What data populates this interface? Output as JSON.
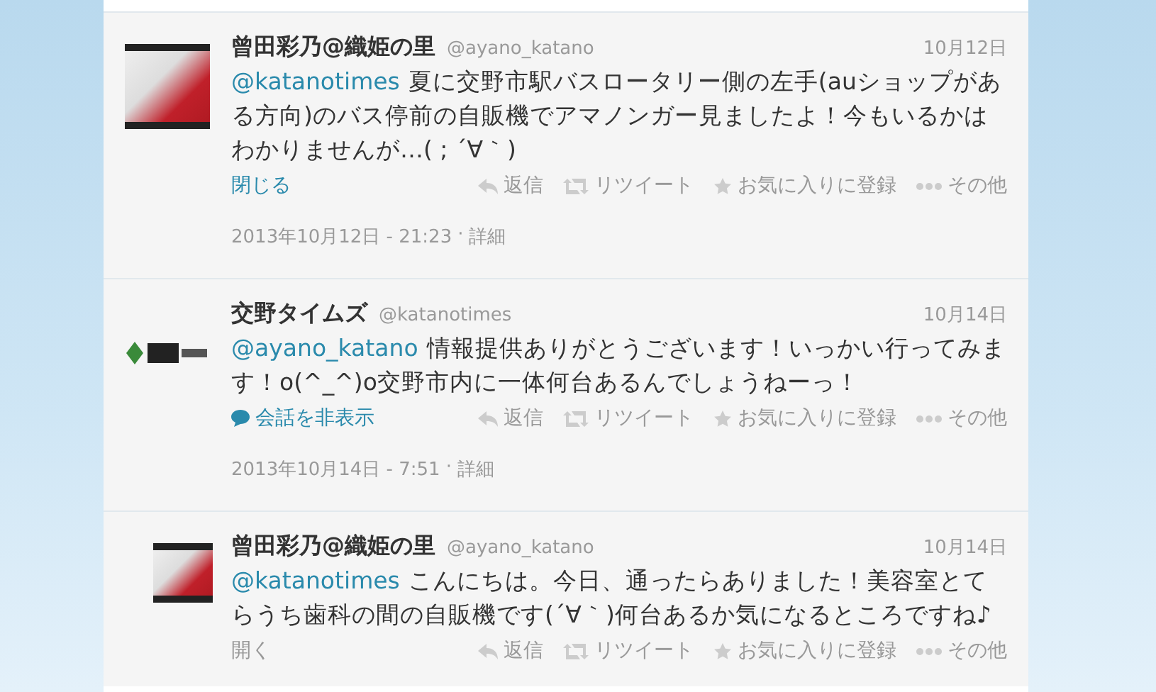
{
  "tweets": [
    {
      "indented": false,
      "avatar": {
        "kind": "photo"
      },
      "name": "曾田彩乃@織姫の里",
      "handle": "@ayano_katano",
      "date": "10月12日",
      "mention": "@katanotimes",
      "text": "夏に交野市駅バスロータリー側の左手(auショップがある方向)のバス停前の自販機でアマノンガー見ましたよ！今もいるかはわかりませんが…( ; ´∀｀)",
      "toggle": {
        "kind": "close",
        "label": "閉じる"
      },
      "actions": [
        "返信",
        "リツイート",
        "お気に入りに登録",
        "その他"
      ],
      "timestamp": "2013年10月12日 - 21:23",
      "separator": "·",
      "detail": "詳細"
    },
    {
      "indented": false,
      "avatar": {
        "kind": "logo"
      },
      "name": "交野タイムズ",
      "handle": "@katanotimes",
      "date": "10月14日",
      "mention": "@ayano_katano",
      "text": "情報提供ありがとうございます！いっかい行ってみます！o(^_^)o交野市内に一体何台あるんでしょうねーっ！",
      "toggle": {
        "kind": "conversation",
        "label": "会話を非表示"
      },
      "actions": [
        "返信",
        "リツイート",
        "お気に入りに登録",
        "その他"
      ],
      "timestamp": "2013年10月14日 - 7:51",
      "separator": "·",
      "detail": "詳細"
    },
    {
      "indented": true,
      "avatar": {
        "kind": "photo"
      },
      "name": "曾田彩乃@織姫の里",
      "handle": "@ayano_katano",
      "date": "10月14日",
      "mention": "@katanotimes",
      "text": "こんにちは。今日、通ったらありました！美容室とてらうち歯科の間の自販機です(´∀｀)何台あるか気になるところですね♪",
      "toggle": {
        "kind": "open",
        "label": "開く"
      },
      "actions": [
        "返信",
        "リツイート",
        "お気に入りに登録",
        "その他"
      ]
    }
  ]
}
